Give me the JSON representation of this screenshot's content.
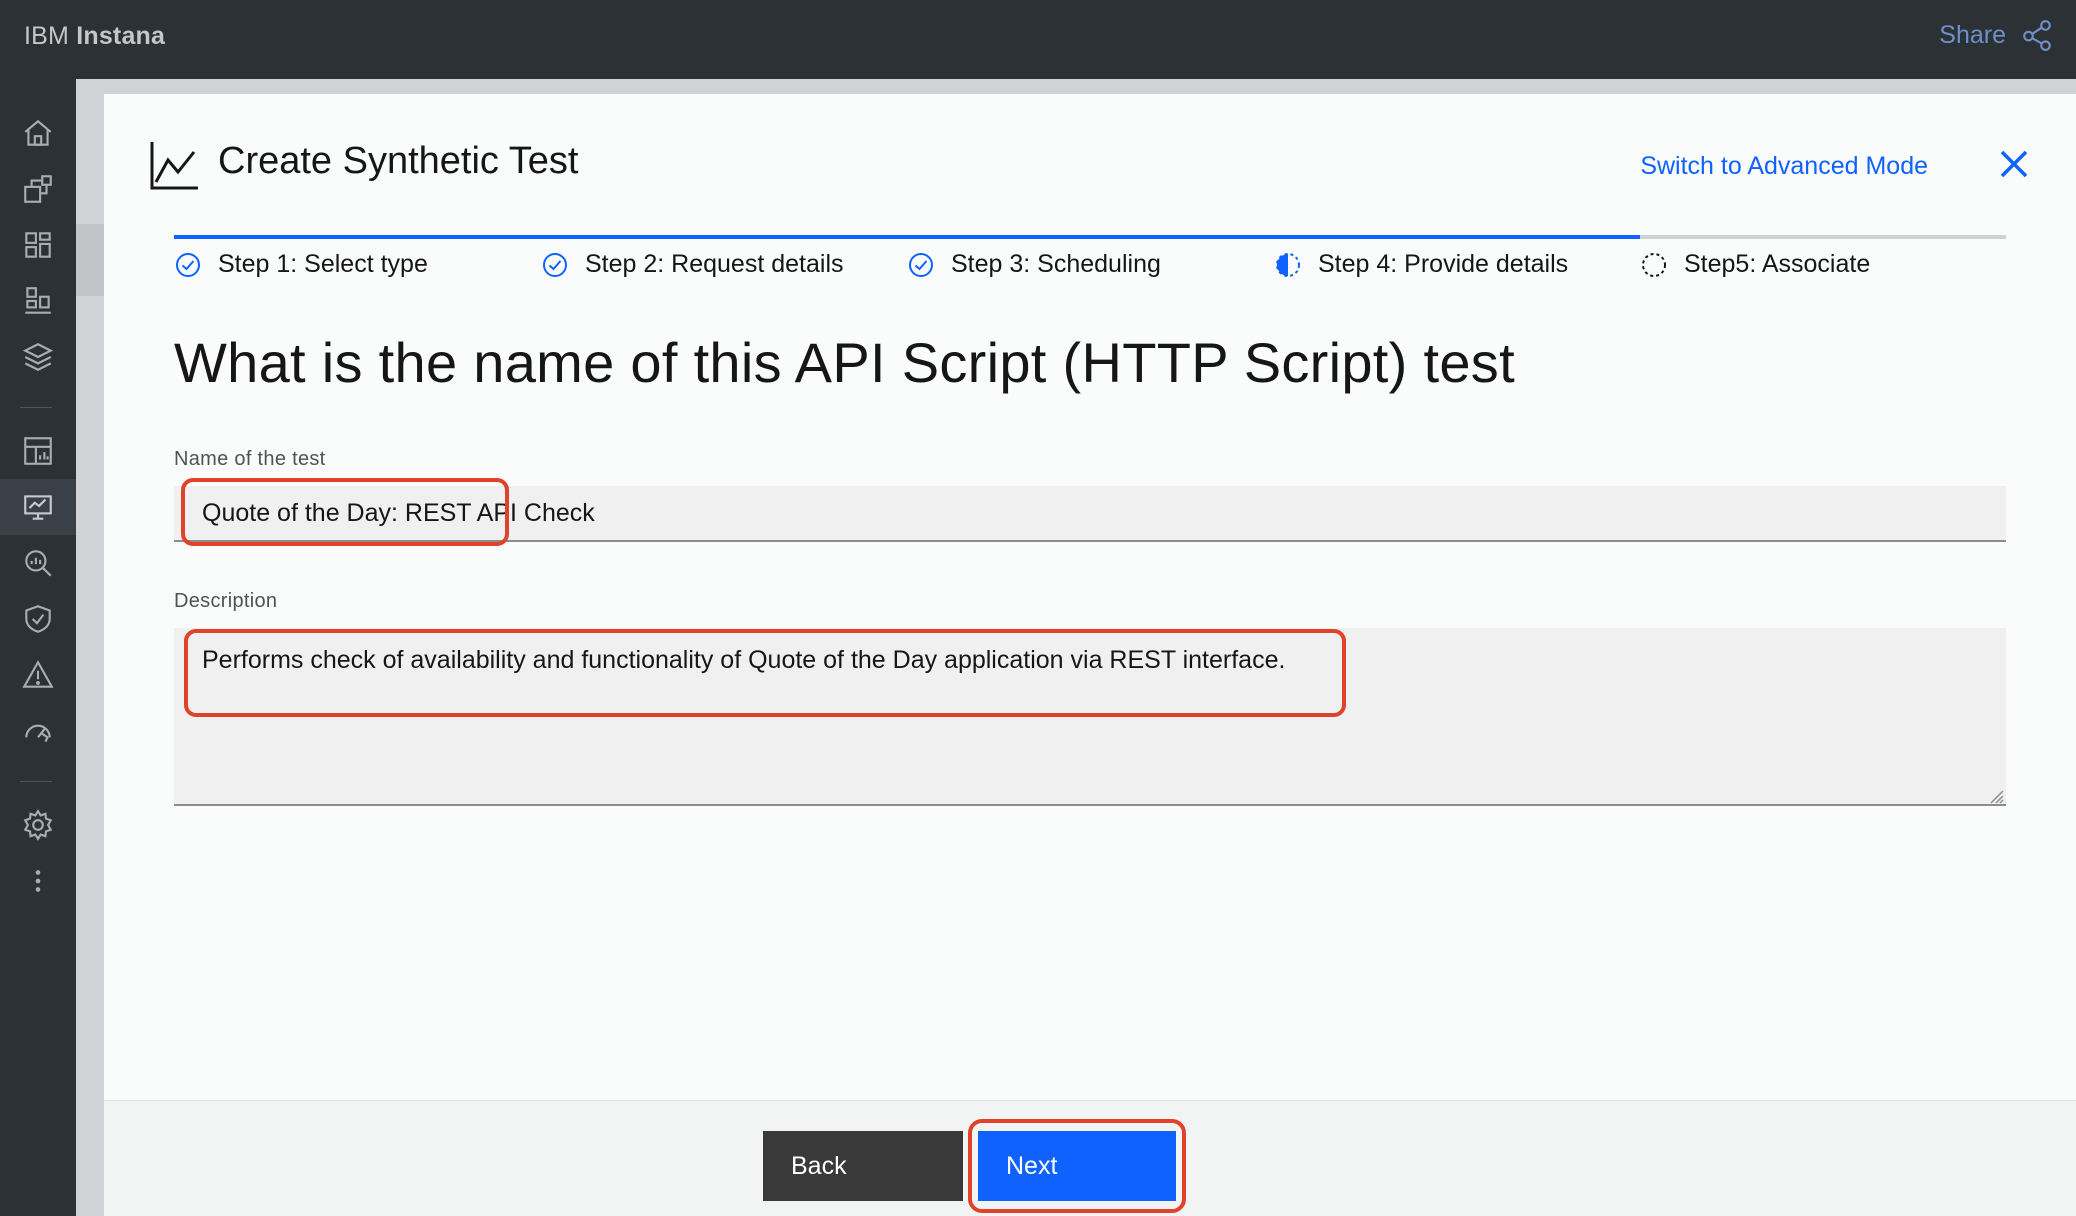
{
  "header": {
    "brand_prefix": "IBM",
    "brand_name": "Instana",
    "share_label": "Share"
  },
  "sidebar": {
    "items": [
      {
        "name": "home-icon"
      },
      {
        "name": "applications-icon"
      },
      {
        "name": "platforms-icon"
      },
      {
        "name": "infrastructure-icon"
      },
      {
        "name": "stack-icon"
      },
      {
        "name": "dashboards-icon"
      },
      {
        "name": "synthetic-monitoring-icon",
        "active": true
      },
      {
        "name": "analytics-icon"
      },
      {
        "name": "security-icon"
      },
      {
        "name": "alerts-icon"
      },
      {
        "name": "performance-icon"
      },
      {
        "name": "settings-icon"
      },
      {
        "name": "more-icon"
      }
    ]
  },
  "modal": {
    "title": "Create Synthetic Test",
    "advanced_mode_label": "Switch to Advanced Mode",
    "progress_fraction": 0.8,
    "steps": [
      {
        "label": "Step 1: Select type",
        "status": "complete"
      },
      {
        "label": "Step 2: Request details",
        "status": "complete"
      },
      {
        "label": "Step 3: Scheduling",
        "status": "complete"
      },
      {
        "label": "Step 4: Provide details",
        "status": "current"
      },
      {
        "label": "Step5: Associate",
        "status": "incomplete"
      }
    ],
    "question": "What is the name of this API Script (HTTP Script) test",
    "name_label": "Name of the test",
    "name_value": "Quote of the Day: REST API Check",
    "description_label": "Description",
    "description_value": "Performs check of availability and functionality of Quote of the Day application via REST interface.",
    "back_label": "Back",
    "next_label": "Next"
  },
  "colors": {
    "accent": "#0f62fe",
    "header_bg": "#2c3136",
    "highlight": "#e0432b"
  }
}
